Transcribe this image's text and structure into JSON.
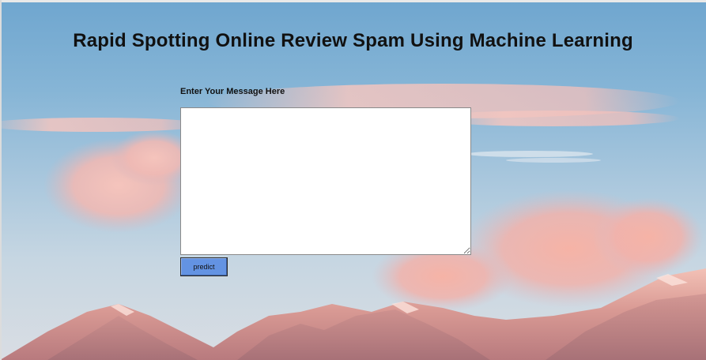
{
  "page": {
    "title": "Rapid Spotting Online Review Spam Using Machine Learning"
  },
  "form": {
    "message_label": "Enter Your Message Here",
    "message_value": "",
    "predict_label": "predict"
  },
  "colors": {
    "button_fill": "#6393e3",
    "sky": "#86b5d6",
    "cloud_pink": "#f2bcb4",
    "mountain_pink": "#e8a9a0"
  }
}
